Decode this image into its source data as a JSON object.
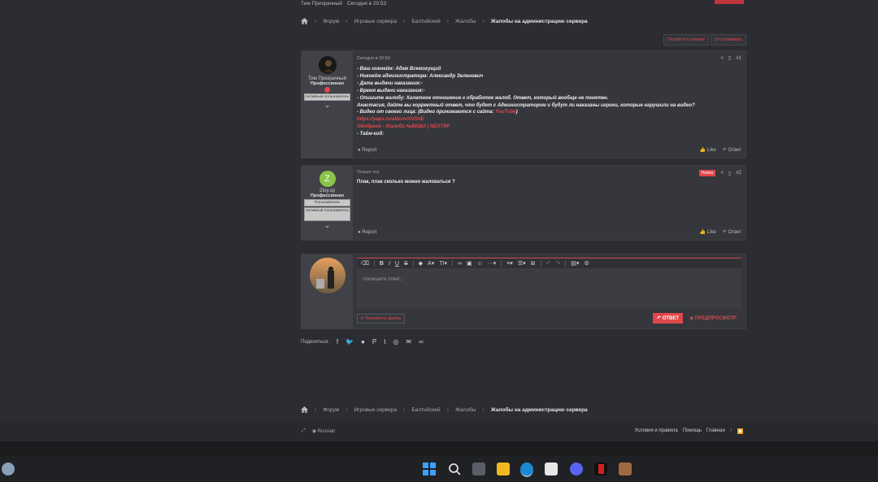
{
  "meta": {
    "author": "Тим Призрачный",
    "time": "Сегодня в 20:53"
  },
  "breadcrumbs": [
    "Форум",
    "Игровые сервера",
    "Балтийский",
    "Жалобы",
    "Жалобы на администрацию сервера"
  ],
  "actions": {
    "move": "Перейти к новому",
    "watch": "Отслеживать"
  },
  "posts": [
    {
      "user": "Тим Призрачный",
      "title": "Профессионал",
      "badges": [
        "Активный пользователь"
      ],
      "time": "Сегодня в 20:53",
      "num": "#1",
      "lines": [
        "- Ваш никнейм: Адам Всемогущий",
        "- Никнейм администратора: Александр Зеленович",
        "- Дата выдачи наказания:-",
        "- Время выдачи наказания:-",
        "- Опишите жалобу: Халатное отношение к обработке жалоб. Ответ, который вообще не понятен.",
        "Анастасия, дайте вы корректный ответ, что будет с Администратором и будут ли наказаны игроки, которые нарушили на видео?",
        "- Видео от своего лица: (Видео принимаются с сайта:",
        "YouTube",
        ")",
        "https://yapx.ru/album/XVDnE",
        "Одобрено - Жалоба №8018А | NEXTRP",
        "- Тайм-код:"
      ],
      "report": "Report",
      "like": "Like",
      "reply": "Ответ"
    },
    {
      "user": "Zloy.xp",
      "avatar_letter": "Z",
      "title": "Профессионал",
      "badges": [
        "Пользователь",
        "Активный пользователь"
      ],
      "time": "Только что",
      "new": "Новое",
      "num": "#2",
      "text": "Плак, плак сколько можно жаловаться ?",
      "report": "Report",
      "like": "Like",
      "reply": "Ответ"
    }
  ],
  "editor": {
    "placeholder": "Напишите ответ...",
    "attach": "Прикрепить файлы",
    "reply": "ОТВЕТ",
    "preview": "ПРЕДПРОСМОТР"
  },
  "share": {
    "label": "Поделиться:"
  },
  "footer": {
    "lang": "Russian",
    "links": [
      "Условия и правила",
      "Помощь",
      "Главная"
    ]
  },
  "colors": {
    "accent": "#e0474b",
    "bg": "#2b2d32"
  }
}
